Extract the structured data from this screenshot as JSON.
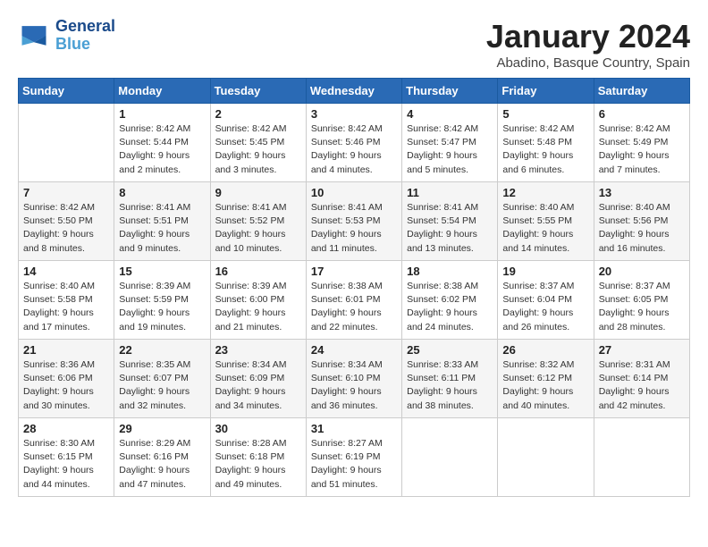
{
  "header": {
    "logo_line1": "General",
    "logo_line2": "Blue",
    "month": "January 2024",
    "location": "Abadino, Basque Country, Spain"
  },
  "weekdays": [
    "Sunday",
    "Monday",
    "Tuesday",
    "Wednesday",
    "Thursday",
    "Friday",
    "Saturday"
  ],
  "weeks": [
    [
      {
        "day": "",
        "info": ""
      },
      {
        "day": "1",
        "info": "Sunrise: 8:42 AM\nSunset: 5:44 PM\nDaylight: 9 hours\nand 2 minutes."
      },
      {
        "day": "2",
        "info": "Sunrise: 8:42 AM\nSunset: 5:45 PM\nDaylight: 9 hours\nand 3 minutes."
      },
      {
        "day": "3",
        "info": "Sunrise: 8:42 AM\nSunset: 5:46 PM\nDaylight: 9 hours\nand 4 minutes."
      },
      {
        "day": "4",
        "info": "Sunrise: 8:42 AM\nSunset: 5:47 PM\nDaylight: 9 hours\nand 5 minutes."
      },
      {
        "day": "5",
        "info": "Sunrise: 8:42 AM\nSunset: 5:48 PM\nDaylight: 9 hours\nand 6 minutes."
      },
      {
        "day": "6",
        "info": "Sunrise: 8:42 AM\nSunset: 5:49 PM\nDaylight: 9 hours\nand 7 minutes."
      }
    ],
    [
      {
        "day": "7",
        "info": "Sunrise: 8:42 AM\nSunset: 5:50 PM\nDaylight: 9 hours\nand 8 minutes."
      },
      {
        "day": "8",
        "info": "Sunrise: 8:41 AM\nSunset: 5:51 PM\nDaylight: 9 hours\nand 9 minutes."
      },
      {
        "day": "9",
        "info": "Sunrise: 8:41 AM\nSunset: 5:52 PM\nDaylight: 9 hours\nand 10 minutes."
      },
      {
        "day": "10",
        "info": "Sunrise: 8:41 AM\nSunset: 5:53 PM\nDaylight: 9 hours\nand 11 minutes."
      },
      {
        "day": "11",
        "info": "Sunrise: 8:41 AM\nSunset: 5:54 PM\nDaylight: 9 hours\nand 13 minutes."
      },
      {
        "day": "12",
        "info": "Sunrise: 8:40 AM\nSunset: 5:55 PM\nDaylight: 9 hours\nand 14 minutes."
      },
      {
        "day": "13",
        "info": "Sunrise: 8:40 AM\nSunset: 5:56 PM\nDaylight: 9 hours\nand 16 minutes."
      }
    ],
    [
      {
        "day": "14",
        "info": "Sunrise: 8:40 AM\nSunset: 5:58 PM\nDaylight: 9 hours\nand 17 minutes."
      },
      {
        "day": "15",
        "info": "Sunrise: 8:39 AM\nSunset: 5:59 PM\nDaylight: 9 hours\nand 19 minutes."
      },
      {
        "day": "16",
        "info": "Sunrise: 8:39 AM\nSunset: 6:00 PM\nDaylight: 9 hours\nand 21 minutes."
      },
      {
        "day": "17",
        "info": "Sunrise: 8:38 AM\nSunset: 6:01 PM\nDaylight: 9 hours\nand 22 minutes."
      },
      {
        "day": "18",
        "info": "Sunrise: 8:38 AM\nSunset: 6:02 PM\nDaylight: 9 hours\nand 24 minutes."
      },
      {
        "day": "19",
        "info": "Sunrise: 8:37 AM\nSunset: 6:04 PM\nDaylight: 9 hours\nand 26 minutes."
      },
      {
        "day": "20",
        "info": "Sunrise: 8:37 AM\nSunset: 6:05 PM\nDaylight: 9 hours\nand 28 minutes."
      }
    ],
    [
      {
        "day": "21",
        "info": "Sunrise: 8:36 AM\nSunset: 6:06 PM\nDaylight: 9 hours\nand 30 minutes."
      },
      {
        "day": "22",
        "info": "Sunrise: 8:35 AM\nSunset: 6:07 PM\nDaylight: 9 hours\nand 32 minutes."
      },
      {
        "day": "23",
        "info": "Sunrise: 8:34 AM\nSunset: 6:09 PM\nDaylight: 9 hours\nand 34 minutes."
      },
      {
        "day": "24",
        "info": "Sunrise: 8:34 AM\nSunset: 6:10 PM\nDaylight: 9 hours\nand 36 minutes."
      },
      {
        "day": "25",
        "info": "Sunrise: 8:33 AM\nSunset: 6:11 PM\nDaylight: 9 hours\nand 38 minutes."
      },
      {
        "day": "26",
        "info": "Sunrise: 8:32 AM\nSunset: 6:12 PM\nDaylight: 9 hours\nand 40 minutes."
      },
      {
        "day": "27",
        "info": "Sunrise: 8:31 AM\nSunset: 6:14 PM\nDaylight: 9 hours\nand 42 minutes."
      }
    ],
    [
      {
        "day": "28",
        "info": "Sunrise: 8:30 AM\nSunset: 6:15 PM\nDaylight: 9 hours\nand 44 minutes."
      },
      {
        "day": "29",
        "info": "Sunrise: 8:29 AM\nSunset: 6:16 PM\nDaylight: 9 hours\nand 47 minutes."
      },
      {
        "day": "30",
        "info": "Sunrise: 8:28 AM\nSunset: 6:18 PM\nDaylight: 9 hours\nand 49 minutes."
      },
      {
        "day": "31",
        "info": "Sunrise: 8:27 AM\nSunset: 6:19 PM\nDaylight: 9 hours\nand 51 minutes."
      },
      {
        "day": "",
        "info": ""
      },
      {
        "day": "",
        "info": ""
      },
      {
        "day": "",
        "info": ""
      }
    ]
  ]
}
